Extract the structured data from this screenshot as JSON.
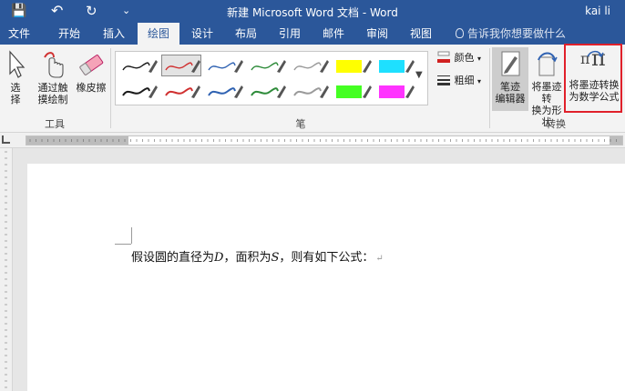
{
  "titlebar": {
    "title": "新建 Microsoft Word 文档 - Word",
    "user": "kai li",
    "save_icon": "💾",
    "undo_icon": "↶",
    "redo_icon": "↻",
    "customize_icon": "⌄"
  },
  "tabs": [
    "文件",
    "开始",
    "插入",
    "绘图",
    "设计",
    "布局",
    "引用",
    "邮件",
    "审阅",
    "视图"
  ],
  "active_tab": "绘图",
  "tell_me": "告诉我你想要做什么",
  "ribbon": {
    "tools": {
      "select_label_1": "选",
      "select_label_2": "择",
      "touch_label_1": "通过触",
      "touch_label_2": "摸绘制",
      "eraser_label": "橡皮擦",
      "group_label": "工具"
    },
    "pens": {
      "group_label": "笔",
      "colors": [
        "#1a1a1a",
        "#d03030",
        "#2f62b2",
        "#2e8b3a",
        "#9a9a9a",
        "#ffff00",
        "#1ee0ff",
        "#1a1a1a",
        "#d03030",
        "#2f62b2",
        "#2e8b3a",
        "#9a9a9a",
        "#44ff22",
        "#ff33ff"
      ],
      "color_option": "颜色",
      "thickness_option": "粗细"
    },
    "convert": {
      "ink_editor_1": "笔迹",
      "ink_editor_2": "编辑器",
      "to_shape_1": "将墨迹转",
      "to_shape_2": "换为形状",
      "to_math_1": "将墨迹转换",
      "to_math_2": "为数学公式",
      "group_label": "转换",
      "math_glyph": "π"
    }
  },
  "document": {
    "text_prefix": "假设圆的直径为",
    "var_d": "D",
    "text_mid": "，面积为",
    "var_s": "S",
    "text_suffix": "，则有如下公式：",
    "para_mark": "↵"
  }
}
